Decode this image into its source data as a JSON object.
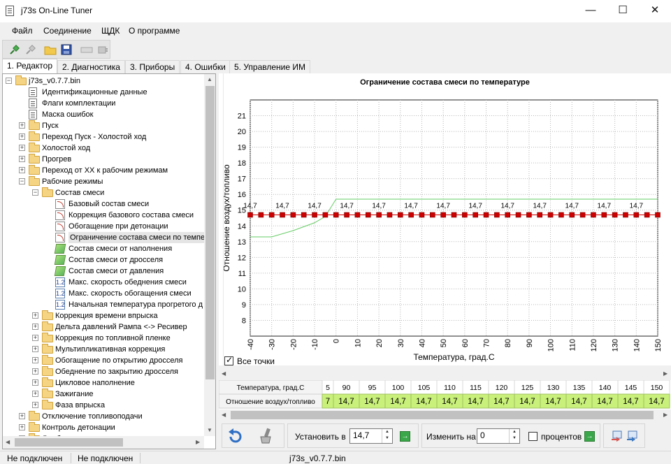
{
  "window": {
    "title": "j73s On-Line Tuner",
    "minimize": "—",
    "maximize": "☐",
    "close": "✕"
  },
  "menu": [
    "Файл",
    "Соединение",
    "ЩДК",
    "О программе"
  ],
  "toolbar_icons": [
    "connect-icon",
    "disconnect-icon",
    "open-folder-icon",
    "save-icon",
    "ecu-icon",
    "plug-icon"
  ],
  "tabs": [
    {
      "label": "1. Редактор",
      "active": true
    },
    {
      "label": "2. Диагностика",
      "active": false
    },
    {
      "label": "3. Приборы",
      "active": false
    },
    {
      "label": "4. Ошибки",
      "active": false
    },
    {
      "label": "5. Управление ИМ",
      "active": false
    }
  ],
  "tree": [
    {
      "label": "j73s_v0.7.7.bin",
      "level": 0,
      "icon": "folder-open",
      "expander": "-"
    },
    {
      "label": "Идентификационные данные",
      "level": 1,
      "icon": "doc",
      "expander": ""
    },
    {
      "label": "Флаги комплектации",
      "level": 1,
      "icon": "doc",
      "expander": ""
    },
    {
      "label": "Маска ошибок",
      "level": 1,
      "icon": "doc",
      "expander": ""
    },
    {
      "label": "Пуск",
      "level": 1,
      "icon": "folder",
      "expander": "+"
    },
    {
      "label": "Переход Пуск - Холостой ход",
      "level": 1,
      "icon": "folder",
      "expander": "+"
    },
    {
      "label": "Холостой ход",
      "level": 1,
      "icon": "folder",
      "expander": "+"
    },
    {
      "label": "Прогрев",
      "level": 1,
      "icon": "folder",
      "expander": "+"
    },
    {
      "label": "Переход от ХХ к рабочим режимам",
      "level": 1,
      "icon": "folder",
      "expander": "+"
    },
    {
      "label": "Рабочие режимы",
      "level": 1,
      "icon": "folder-open",
      "expander": "-"
    },
    {
      "label": "Состав смеси",
      "level": 2,
      "icon": "folder-open",
      "expander": "-"
    },
    {
      "label": "Базовый состав смеси",
      "level": 3,
      "icon": "curve",
      "expander": ""
    },
    {
      "label": "Коррекция базового состава смеси",
      "level": 3,
      "icon": "curve",
      "expander": ""
    },
    {
      "label": "Обогащение при детонации",
      "level": 3,
      "icon": "curve",
      "expander": ""
    },
    {
      "label": "Ограничение состава смеси по темпе",
      "level": 3,
      "icon": "curve",
      "expander": "",
      "selected": true
    },
    {
      "label": "Состав смеси от наполнения",
      "level": 3,
      "icon": "surf",
      "expander": ""
    },
    {
      "label": "Состав смеси от дросселя",
      "level": 3,
      "icon": "surf",
      "expander": ""
    },
    {
      "label": "Состав смеси от давления",
      "level": 3,
      "icon": "surf",
      "expander": ""
    },
    {
      "label": "Макс. скорость обеднения смеси",
      "level": 3,
      "icon": "num",
      "expander": ""
    },
    {
      "label": "Макс. скорость обогащения смеси",
      "level": 3,
      "icon": "num",
      "expander": ""
    },
    {
      "label": "Начальная температура прогретого д",
      "level": 3,
      "icon": "num",
      "expander": ""
    },
    {
      "label": "Коррекция времени впрыска",
      "level": 2,
      "icon": "folder",
      "expander": "+"
    },
    {
      "label": "Дельта давлений Рампа <-> Ресивер",
      "level": 2,
      "icon": "folder",
      "expander": "+"
    },
    {
      "label": "Коррекция по топливной пленке",
      "level": 2,
      "icon": "folder",
      "expander": "+"
    },
    {
      "label": "Мультипликативная коррекция",
      "level": 2,
      "icon": "folder",
      "expander": "+"
    },
    {
      "label": "Обогащение по открытию дросселя",
      "level": 2,
      "icon": "folder",
      "expander": "+"
    },
    {
      "label": "Обеднение по закрытию дросселя",
      "level": 2,
      "icon": "folder",
      "expander": "+"
    },
    {
      "label": "Цикловое наполнение",
      "level": 2,
      "icon": "folder",
      "expander": "+"
    },
    {
      "label": "Зажигание",
      "level": 2,
      "icon": "folder",
      "expander": "+"
    },
    {
      "label": "Фаза впрыска",
      "level": 2,
      "icon": "folder",
      "expander": "+"
    },
    {
      "label": "Отключение топливоподачи",
      "level": 1,
      "icon": "folder",
      "expander": "+"
    },
    {
      "label": "Контроль детонации",
      "level": 1,
      "icon": "folder",
      "expander": "+"
    },
    {
      "label": "Лямбда регулирование",
      "level": 1,
      "icon": "folder",
      "expander": "+"
    }
  ],
  "chart_data": {
    "type": "line",
    "title": "Ограничение состава смеси по температуре",
    "xlabel": "Температура, град.С",
    "ylabel": "Отношение воздух/топливо",
    "xlim": [
      -40,
      150
    ],
    "ylim": [
      7,
      22
    ],
    "xticks": [
      -40,
      -30,
      -20,
      -10,
      0,
      10,
      20,
      30,
      40,
      50,
      60,
      70,
      80,
      90,
      100,
      110,
      120,
      130,
      140,
      150
    ],
    "yticks": [
      8,
      9,
      10,
      11,
      12,
      13,
      14,
      15,
      16,
      17,
      18,
      19,
      20,
      21
    ],
    "grid": true,
    "series": [
      {
        "name": "",
        "color": "#cc0000",
        "x": [
          -40,
          -35,
          -30,
          -25,
          -20,
          -15,
          -10,
          -5,
          0,
          5,
          10,
          15,
          20,
          25,
          30,
          35,
          40,
          45,
          50,
          55,
          60,
          65,
          70,
          75,
          80,
          85,
          90,
          95,
          100,
          105,
          110,
          115,
          120,
          125,
          130,
          135,
          140,
          145,
          150
        ],
        "y": [
          14.7,
          14.7,
          14.7,
          14.7,
          14.7,
          14.7,
          14.7,
          14.7,
          14.7,
          14.7,
          14.7,
          14.7,
          14.7,
          14.7,
          14.7,
          14.7,
          14.7,
          14.7,
          14.7,
          14.7,
          14.7,
          14.7,
          14.7,
          14.7,
          14.7,
          14.7,
          14.7,
          14.7,
          14.7,
          14.7,
          14.7,
          14.7,
          14.7,
          14.7,
          14.7,
          14.7,
          14.7,
          14.7,
          14.7
        ]
      },
      {
        "name": "",
        "color": "#66cc66",
        "x": [
          -40,
          -30,
          -20,
          -10,
          -5,
          0,
          150
        ],
        "y": [
          13.3,
          13.3,
          13.7,
          14.2,
          14.6,
          15.7,
          15.7
        ]
      }
    ],
    "data_labels": {
      "x": [
        -40,
        -25,
        -10,
        5,
        20,
        35,
        50,
        65,
        80,
        95,
        110,
        125,
        140
      ],
      "text": "14,7"
    }
  },
  "show_all_points_label": "Все точки",
  "grid_table": {
    "row_headers": [
      "Температура, град.С",
      "Отношение воздух/топливо"
    ],
    "columns": [
      {
        "t": "5",
        "v": "7"
      },
      {
        "t": "90",
        "v": "14,7"
      },
      {
        "t": "95",
        "v": "14,7"
      },
      {
        "t": "100",
        "v": "14,7"
      },
      {
        "t": "105",
        "v": "14,7"
      },
      {
        "t": "110",
        "v": "14,7"
      },
      {
        "t": "115",
        "v": "14,7"
      },
      {
        "t": "120",
        "v": "14,7"
      },
      {
        "t": "125",
        "v": "14,7"
      },
      {
        "t": "130",
        "v": "14,7"
      },
      {
        "t": "135",
        "v": "14,7"
      },
      {
        "t": "140",
        "v": "14,7"
      },
      {
        "t": "145",
        "v": "14,7"
      },
      {
        "t": "150",
        "v": "14,7"
      }
    ]
  },
  "bottom": {
    "set_label": "Установить в",
    "set_value": "14,7",
    "change_label": "Изменить на",
    "change_value": "0",
    "percent_label": "процентов"
  },
  "status": [
    "Не подключен",
    "Не подключен",
    "j73s_v0.7.7.bin"
  ],
  "colors": {
    "accent": "#0078d7",
    "grid_cell": "#c8f07a",
    "marker": "#cc0000",
    "limit_line": "#66cc66"
  }
}
